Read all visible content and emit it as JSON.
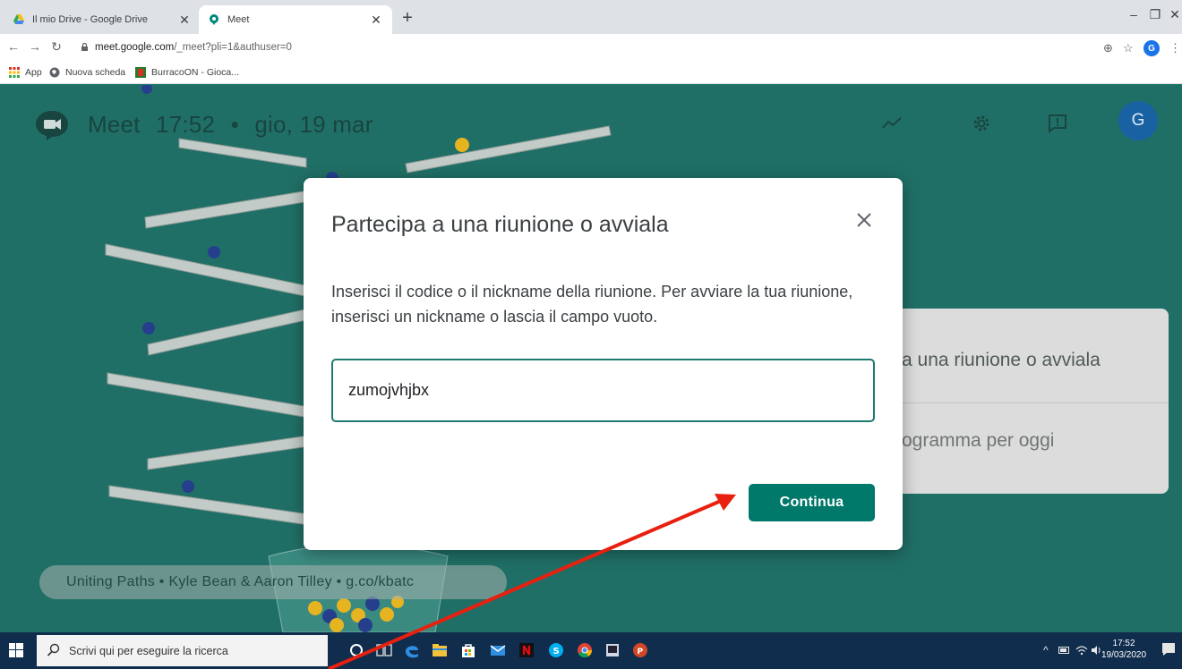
{
  "browser": {
    "tabs": [
      {
        "title": "Il mio Drive - Google Drive",
        "icon": "google-drive-icon",
        "active": false
      },
      {
        "title": "Meet",
        "icon": "meet-icon",
        "active": true
      }
    ],
    "url_host": "meet.google.com",
    "url_path": "/_meet?pli=1&authuser=0",
    "profile_initial": "G",
    "bookmarks": [
      {
        "label": "App",
        "icon": "apps-grid-icon"
      },
      {
        "label": "Nuova scheda",
        "icon": "globe-icon"
      },
      {
        "label": "BurracoON - Gioca...",
        "icon": "burraco-icon"
      }
    ]
  },
  "meet": {
    "app_name": "Meet",
    "time": "17:52",
    "separator": "•",
    "date": "gio, 19 mar",
    "avatar_initial": "G",
    "side_card": {
      "row1": "a una riunione o avviala",
      "row2": "ogramma per oggi"
    },
    "credit": "Uniting Paths • Kyle Bean & Aaron Tilley • g.co/kbatc"
  },
  "dialog": {
    "title": "Partecipa a una riunione o avviala",
    "description": "Inserisci il codice o il nickname della riunione. Per avviare la tua riunione, inserisci un nickname o lascia il campo vuoto.",
    "input_value": "zumojvhjbx",
    "continue_label": "Continua"
  },
  "taskbar": {
    "search_placeholder": "Scrivi qui per eseguire la ricerca",
    "time": "17:52",
    "date": "19/03/2020",
    "apps": [
      "cortana-icon",
      "task-view-icon",
      "edge-icon",
      "file-explorer-icon",
      "store-icon",
      "mail-icon",
      "netflix-icon",
      "skype-icon",
      "chrome-icon",
      "tablet-icon",
      "powerpoint-icon"
    ]
  },
  "colors": {
    "meet_background": "#206f66",
    "accent_green": "#00796b",
    "annotation_arrow": "#e8200f"
  }
}
